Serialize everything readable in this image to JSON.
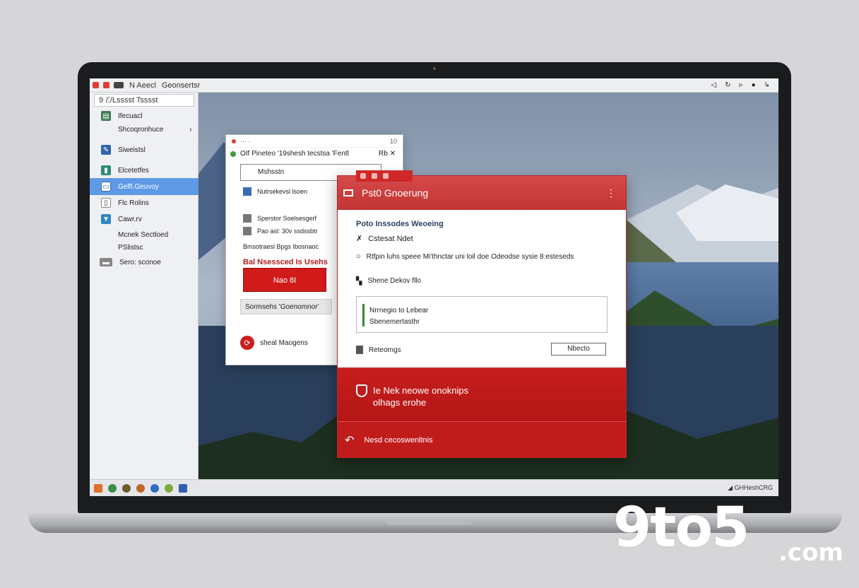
{
  "colors": {
    "accent_red": "#c81e1e",
    "selection_blue": "#5e9ae6",
    "bezel": "#1b1c1e"
  },
  "menubar": {
    "app_label": "N Aeecl",
    "menu_label": "Geonsertsr",
    "right_icons": [
      "back-icon",
      "wifi-icon",
      "volume-icon",
      "power-icon",
      "menu-icon"
    ]
  },
  "sidebar": {
    "search_value": "9 ℰ/Lsssst Tsssst",
    "items": [
      {
        "label": "Ifecuacl",
        "icon": "folder-icon"
      },
      {
        "label": "Shcoqronhuce",
        "icon": ""
      },
      {
        "label": "Siweistsl",
        "icon": "pen-icon"
      },
      {
        "label": "Elcetetfes",
        "icon": "bin-icon"
      },
      {
        "label": "Gelfl.Geuvoy",
        "icon": "monitor-icon",
        "selected": true
      },
      {
        "label": "Flc Rolins",
        "icon": "doc-icon"
      },
      {
        "label": "Cawr.rv",
        "icon": "cup-icon"
      },
      {
        "label": "Mcnek Sectloed",
        "icon": "mail-icon"
      },
      {
        "label": "PSlistsc",
        "icon": ""
      },
      {
        "label": "Sero: sconoe",
        "icon": "drive-icon"
      }
    ]
  },
  "back_window": {
    "title_num": "10",
    "header": "OIf   Pineteo '19shesh tecstsa 'Fentl",
    "header_right": "Rb ✕",
    "field_value": "Mshsstn",
    "row1": "Nutrsekevsl lsoen",
    "row2": "Sperstor Soelsesgerf",
    "row3": "Pao asl: 30v ssdssbtr",
    "row4": "Bmsotraesl Bpgs Ibosnaoc",
    "link": "Bal Nsessced Is Usehs",
    "button": "Nao 8I",
    "button2": "Sormsehs 'Goenomnor'",
    "footer": "sheal Maogens"
  },
  "dialog": {
    "title": "Pst0 Gnoerung",
    "heading": "Poto Inssodes Weoeing",
    "line1": "Cstesat Ndet",
    "line2": "Rtfpin luhs speee Mi'thnctar uni loil doe Odeodse sysie 8:esteseds",
    "line3": "Shene Dekov fllo",
    "box_line1": "Nrrnegio to Lebear",
    "box_line2": "Sbenemertasthr",
    "choose_label": "Reteomgs",
    "input_value": "Nbecto",
    "banner_line1": "Ie Nek neowe onoknips",
    "banner_line2": "olhags erohe",
    "footer_text": "Nesd cecoswenltnis"
  },
  "taskbar": {
    "right_text": "◢  GHHeshCRG"
  },
  "watermark": {
    "brand": "9to5",
    "suffix": ".com"
  }
}
